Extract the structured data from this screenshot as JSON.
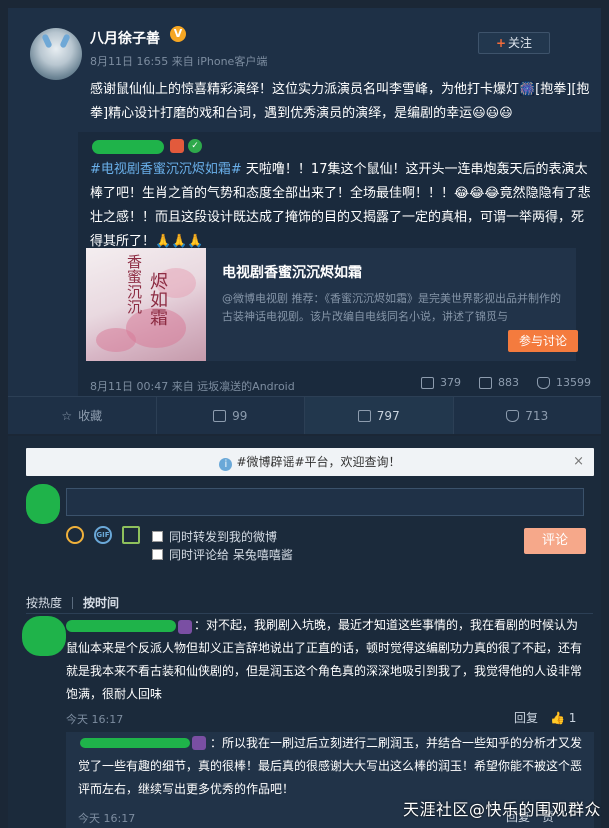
{
  "post": {
    "username": "八月徐子善",
    "verified_badge": "V",
    "meta": "8月11日 16:55 来自 iPhone客户端",
    "follow_label": "关注",
    "text": "感谢鼠仙仙上的惊喜精彩演绎！这位实力派演员名叫李雪峰，为他打卡爆灯🎆[抱拳][抱拳]精心设计打磨的戏和台词，遇到优秀演员的演绎，是编剧的幸运😃😃😃"
  },
  "repost": {
    "hashtag": "#电视剧香蜜沉沉烬如霜#",
    "text": " 天啦噜！！17集这个鼠仙！这开头一连串炮轰天后的表演太棒了吧！生肖之首的气势和态度全部出来了！全场最佳啊！！！😂😂😂竟然隐隐有了悲壮之感！！而且这段设计既达成了掩饰的目的又揭露了一定的真相，可谓一举两得，死得其所了！🙏🙏🙏",
    "card": {
      "title": "电视剧香蜜沉沉烬如霜",
      "desc": "@微博电视剧 推荐：《香蜜沉沉烬如霜》是完美世界影视出品并制作的古装神话电视剧。该片改编自电线同名小说，讲述了锦觅与",
      "button": "参与讨论",
      "img_glyphs": [
        "香蜜沉沉",
        "烬如霜"
      ]
    },
    "meta": "8月11日 00:47 来自 远坂凛送的Android",
    "stats": {
      "repost": "379",
      "comment": "883",
      "like": "13599"
    }
  },
  "actions": {
    "fav": "收藏",
    "repost": "99",
    "comment": "797",
    "like": "713"
  },
  "comments": {
    "notice": "#微博辟谣#平台，欢迎查询！",
    "notice_close": "×",
    "opt_repost": "同时转发到我的微博",
    "opt_comment": "同时评论给 呆兔嘻嘻酱",
    "submit": "评论",
    "sort_hot": "按热度",
    "sort_time": "按时间",
    "c1": {
      "text": "：对不起，我刷剧入坑晚，最近才知道这些事情的，我在看剧的时候认为鼠仙本来是个反派人物但却义正言辞地说出了正直的话，顿时觉得这编剧功力真的很了不起，还有就是我本来不看古装和仙侠剧的，但是润玉这个角色真的深深地吸引到我了，我觉得他的人设非常饱满，很耐人回味",
      "time": "今天 16:17",
      "reply": "回复",
      "likes": "1"
    },
    "c2": {
      "text": "：所以我在一刷过后立刻进行二刷润玉，并结合一些知乎的分析才又发觉了一些有趣的细节，真的很棒！最后真的很感谢大大写出这么棒的润玉！希望你能不被这个恶评而左右，继续写出更多优秀的作品吧！",
      "time": "今天 16:17",
      "reply": "回复",
      "like_label": "赞"
    }
  },
  "watermark": "天涯社区@快乐的围观群众"
}
